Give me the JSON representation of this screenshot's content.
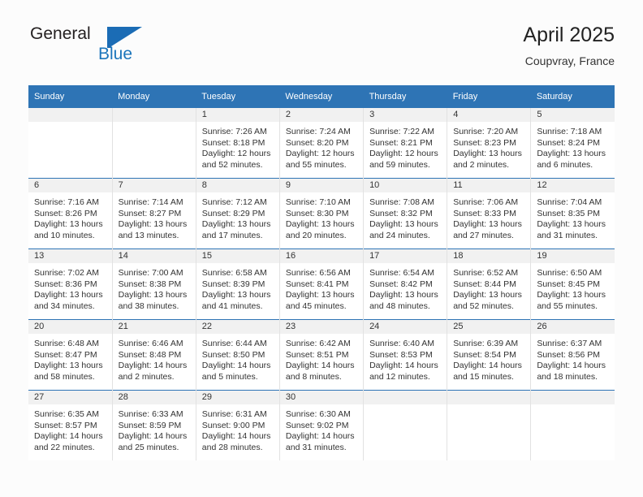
{
  "logo": {
    "primary_text": "General",
    "secondary_text": "Blue",
    "primary_color": "#231f20",
    "secondary_color": "#1b75bb",
    "flag_icon": "blue-flag-icon"
  },
  "header": {
    "title": "April 2025",
    "subtitle": "Coupvray, France"
  },
  "colors": {
    "header_blue": "#2e74b5",
    "daynum_band": "#f1f1f1",
    "cell_border": "#e2e2e2",
    "page_background": "#fcfcfc",
    "text": "#333333"
  },
  "calendar": {
    "weekday_headers": [
      "Sunday",
      "Monday",
      "Tuesday",
      "Wednesday",
      "Thursday",
      "Friday",
      "Saturday"
    ],
    "weeks": [
      [
        {
          "day": "",
          "lines": []
        },
        {
          "day": "",
          "lines": []
        },
        {
          "day": "1",
          "lines": [
            "Sunrise: 7:26 AM",
            "Sunset: 8:18 PM",
            "Daylight: 12 hours",
            "and 52 minutes."
          ]
        },
        {
          "day": "2",
          "lines": [
            "Sunrise: 7:24 AM",
            "Sunset: 8:20 PM",
            "Daylight: 12 hours",
            "and 55 minutes."
          ]
        },
        {
          "day": "3",
          "lines": [
            "Sunrise: 7:22 AM",
            "Sunset: 8:21 PM",
            "Daylight: 12 hours",
            "and 59 minutes."
          ]
        },
        {
          "day": "4",
          "lines": [
            "Sunrise: 7:20 AM",
            "Sunset: 8:23 PM",
            "Daylight: 13 hours",
            "and 2 minutes."
          ]
        },
        {
          "day": "5",
          "lines": [
            "Sunrise: 7:18 AM",
            "Sunset: 8:24 PM",
            "Daylight: 13 hours",
            "and 6 minutes."
          ]
        }
      ],
      [
        {
          "day": "6",
          "lines": [
            "Sunrise: 7:16 AM",
            "Sunset: 8:26 PM",
            "Daylight: 13 hours",
            "and 10 minutes."
          ]
        },
        {
          "day": "7",
          "lines": [
            "Sunrise: 7:14 AM",
            "Sunset: 8:27 PM",
            "Daylight: 13 hours",
            "and 13 minutes."
          ]
        },
        {
          "day": "8",
          "lines": [
            "Sunrise: 7:12 AM",
            "Sunset: 8:29 PM",
            "Daylight: 13 hours",
            "and 17 minutes."
          ]
        },
        {
          "day": "9",
          "lines": [
            "Sunrise: 7:10 AM",
            "Sunset: 8:30 PM",
            "Daylight: 13 hours",
            "and 20 minutes."
          ]
        },
        {
          "day": "10",
          "lines": [
            "Sunrise: 7:08 AM",
            "Sunset: 8:32 PM",
            "Daylight: 13 hours",
            "and 24 minutes."
          ]
        },
        {
          "day": "11",
          "lines": [
            "Sunrise: 7:06 AM",
            "Sunset: 8:33 PM",
            "Daylight: 13 hours",
            "and 27 minutes."
          ]
        },
        {
          "day": "12",
          "lines": [
            "Sunrise: 7:04 AM",
            "Sunset: 8:35 PM",
            "Daylight: 13 hours",
            "and 31 minutes."
          ]
        }
      ],
      [
        {
          "day": "13",
          "lines": [
            "Sunrise: 7:02 AM",
            "Sunset: 8:36 PM",
            "Daylight: 13 hours",
            "and 34 minutes."
          ]
        },
        {
          "day": "14",
          "lines": [
            "Sunrise: 7:00 AM",
            "Sunset: 8:38 PM",
            "Daylight: 13 hours",
            "and 38 minutes."
          ]
        },
        {
          "day": "15",
          "lines": [
            "Sunrise: 6:58 AM",
            "Sunset: 8:39 PM",
            "Daylight: 13 hours",
            "and 41 minutes."
          ]
        },
        {
          "day": "16",
          "lines": [
            "Sunrise: 6:56 AM",
            "Sunset: 8:41 PM",
            "Daylight: 13 hours",
            "and 45 minutes."
          ]
        },
        {
          "day": "17",
          "lines": [
            "Sunrise: 6:54 AM",
            "Sunset: 8:42 PM",
            "Daylight: 13 hours",
            "and 48 minutes."
          ]
        },
        {
          "day": "18",
          "lines": [
            "Sunrise: 6:52 AM",
            "Sunset: 8:44 PM",
            "Daylight: 13 hours",
            "and 52 minutes."
          ]
        },
        {
          "day": "19",
          "lines": [
            "Sunrise: 6:50 AM",
            "Sunset: 8:45 PM",
            "Daylight: 13 hours",
            "and 55 minutes."
          ]
        }
      ],
      [
        {
          "day": "20",
          "lines": [
            "Sunrise: 6:48 AM",
            "Sunset: 8:47 PM",
            "Daylight: 13 hours",
            "and 58 minutes."
          ]
        },
        {
          "day": "21",
          "lines": [
            "Sunrise: 6:46 AM",
            "Sunset: 8:48 PM",
            "Daylight: 14 hours",
            "and 2 minutes."
          ]
        },
        {
          "day": "22",
          "lines": [
            "Sunrise: 6:44 AM",
            "Sunset: 8:50 PM",
            "Daylight: 14 hours",
            "and 5 minutes."
          ]
        },
        {
          "day": "23",
          "lines": [
            "Sunrise: 6:42 AM",
            "Sunset: 8:51 PM",
            "Daylight: 14 hours",
            "and 8 minutes."
          ]
        },
        {
          "day": "24",
          "lines": [
            "Sunrise: 6:40 AM",
            "Sunset: 8:53 PM",
            "Daylight: 14 hours",
            "and 12 minutes."
          ]
        },
        {
          "day": "25",
          "lines": [
            "Sunrise: 6:39 AM",
            "Sunset: 8:54 PM",
            "Daylight: 14 hours",
            "and 15 minutes."
          ]
        },
        {
          "day": "26",
          "lines": [
            "Sunrise: 6:37 AM",
            "Sunset: 8:56 PM",
            "Daylight: 14 hours",
            "and 18 minutes."
          ]
        }
      ],
      [
        {
          "day": "27",
          "lines": [
            "Sunrise: 6:35 AM",
            "Sunset: 8:57 PM",
            "Daylight: 14 hours",
            "and 22 minutes."
          ]
        },
        {
          "day": "28",
          "lines": [
            "Sunrise: 6:33 AM",
            "Sunset: 8:59 PM",
            "Daylight: 14 hours",
            "and 25 minutes."
          ]
        },
        {
          "day": "29",
          "lines": [
            "Sunrise: 6:31 AM",
            "Sunset: 9:00 PM",
            "Daylight: 14 hours",
            "and 28 minutes."
          ]
        },
        {
          "day": "30",
          "lines": [
            "Sunrise: 6:30 AM",
            "Sunset: 9:02 PM",
            "Daylight: 14 hours",
            "and 31 minutes."
          ]
        },
        {
          "day": "",
          "lines": []
        },
        {
          "day": "",
          "lines": []
        },
        {
          "day": "",
          "lines": []
        }
      ]
    ]
  }
}
